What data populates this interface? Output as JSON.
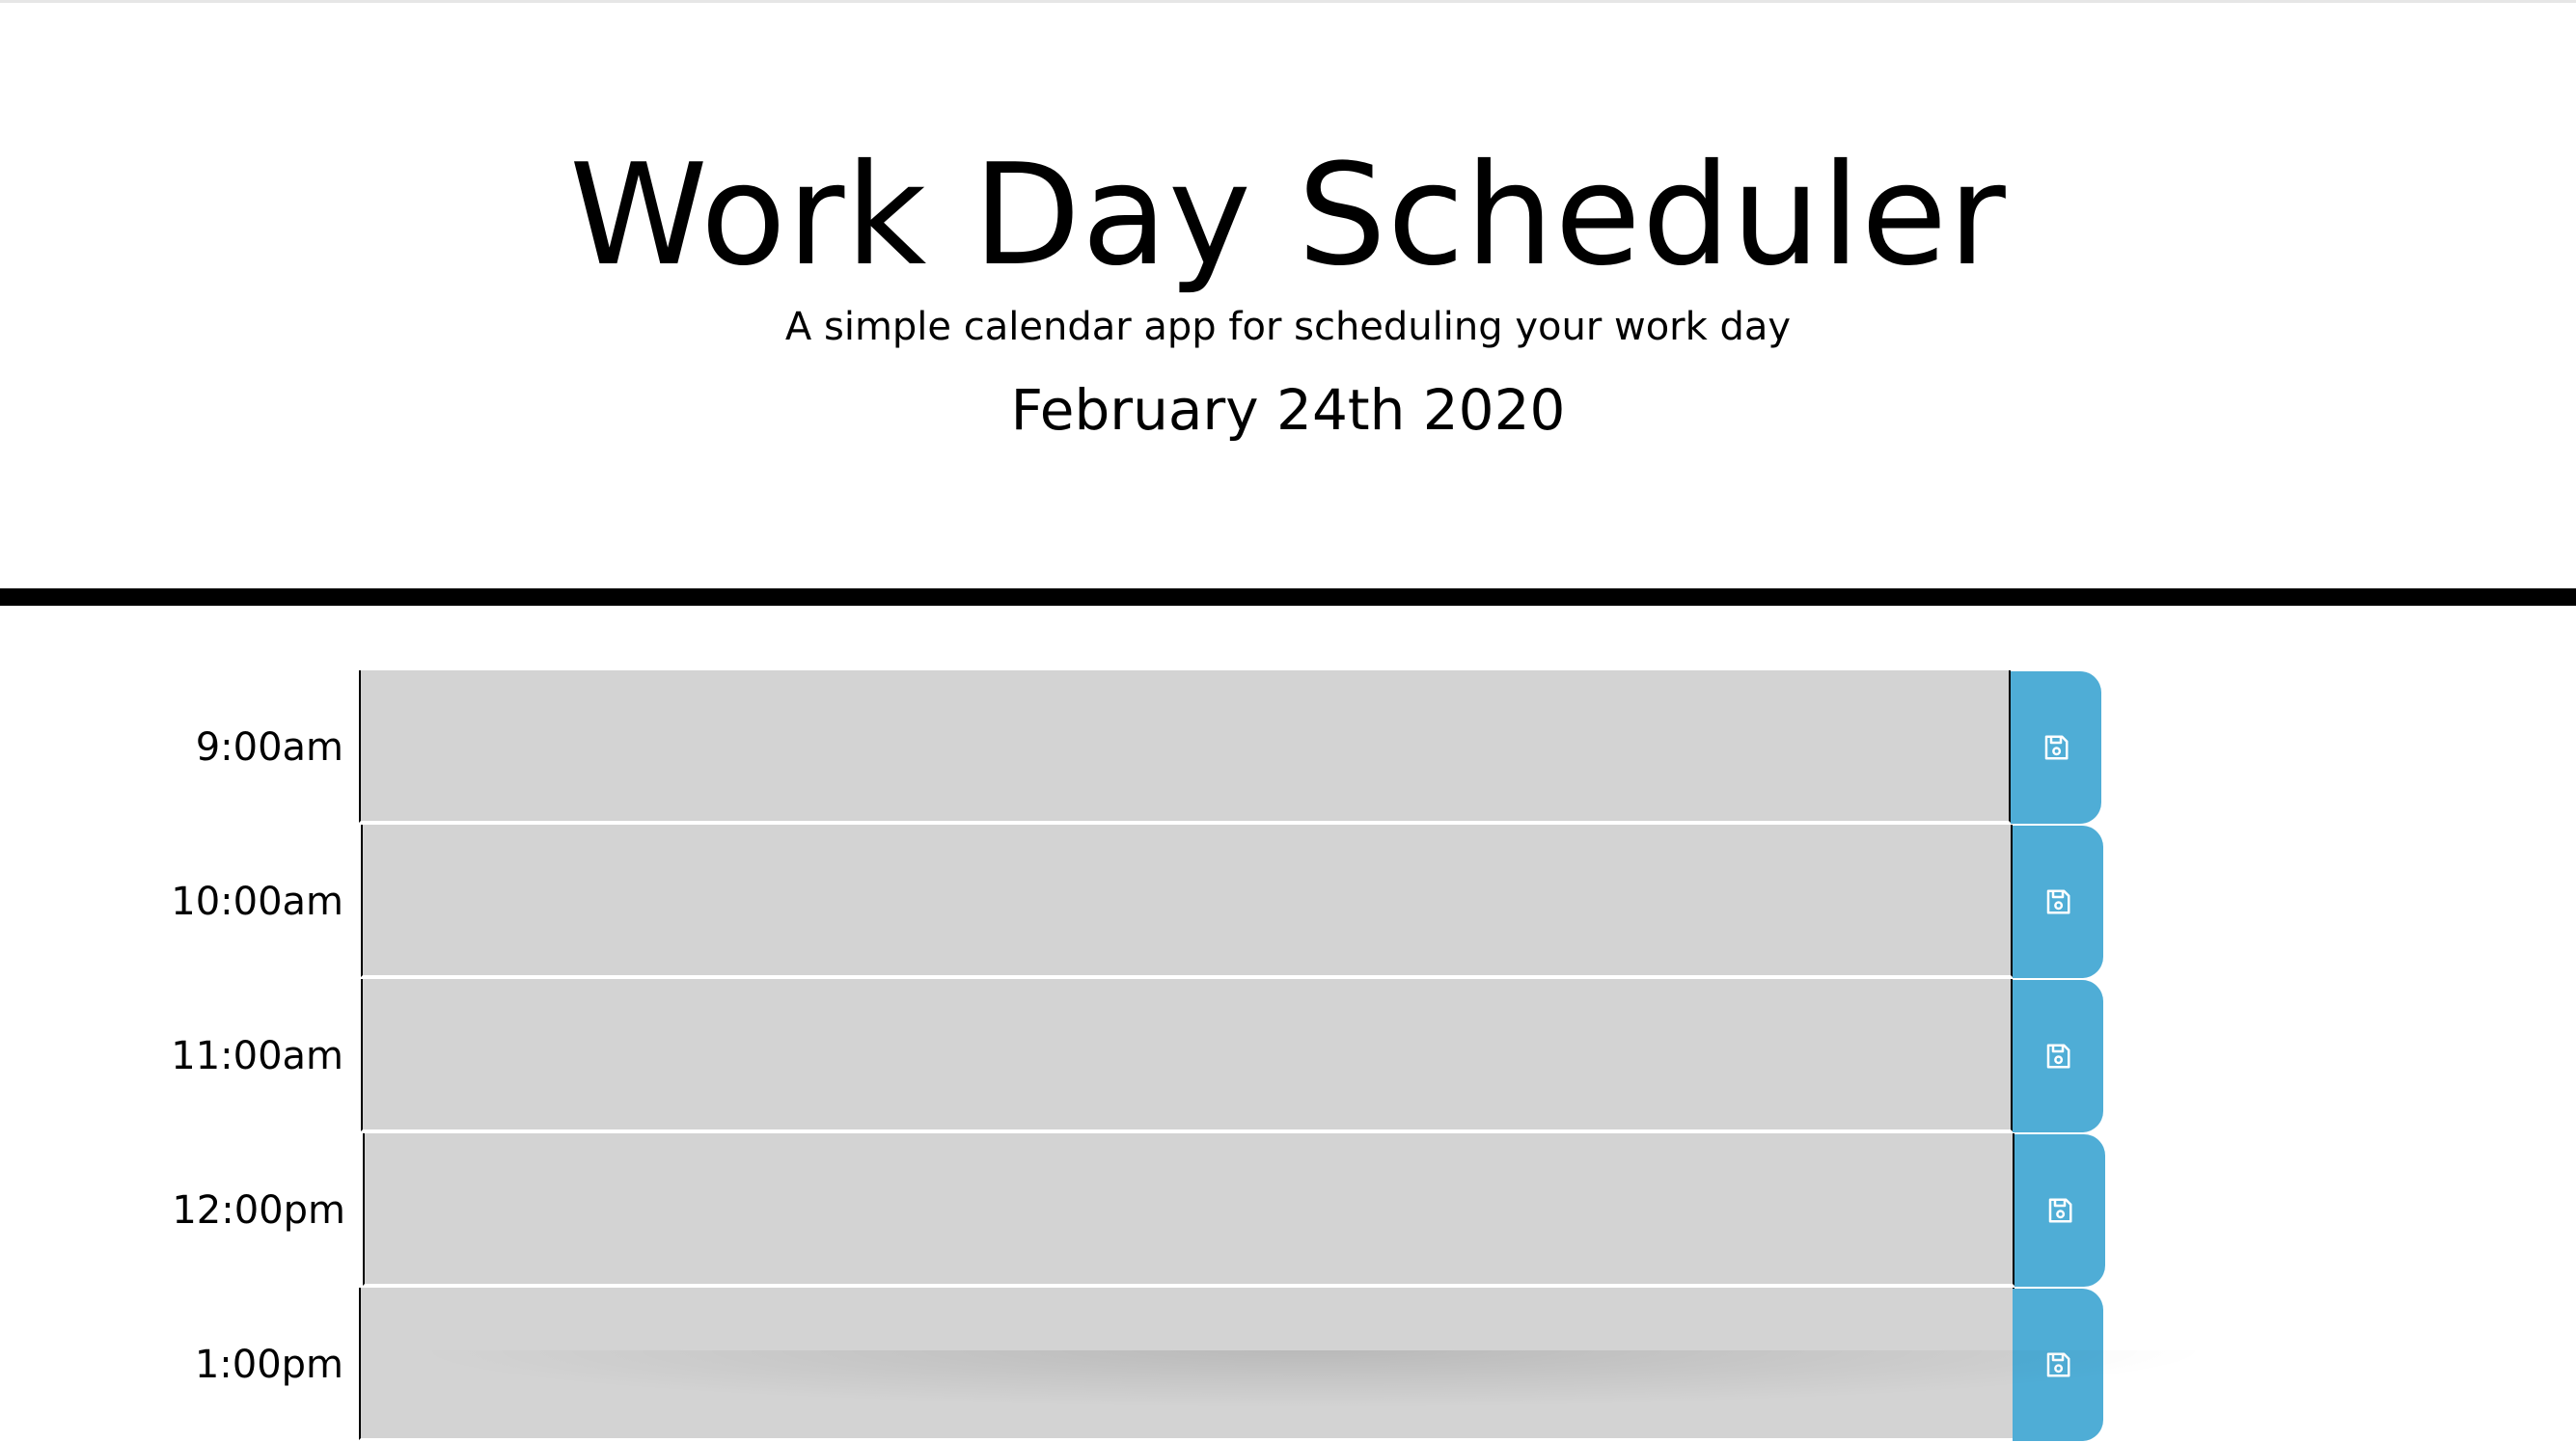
{
  "header": {
    "title": "Work Day Scheduler",
    "subtitle": "A simple calendar app for scheduling your work day",
    "current_day": "February 24th 2020"
  },
  "timeblocks": [
    {
      "hour": "9:00am",
      "description": "",
      "save_icon": "floppy-disk-icon"
    },
    {
      "hour": "10:00am",
      "description": "",
      "save_icon": "floppy-disk-icon"
    },
    {
      "hour": "11:00am",
      "description": "",
      "save_icon": "floppy-disk-icon"
    },
    {
      "hour": "12:00pm",
      "description": "",
      "save_icon": "floppy-disk-icon"
    },
    {
      "hour": "1:00pm",
      "description": "",
      "save_icon": "floppy-disk-icon"
    }
  ],
  "colors": {
    "past": "#d3d3d3",
    "save_button": "#4fadd6",
    "border": "#000000"
  }
}
